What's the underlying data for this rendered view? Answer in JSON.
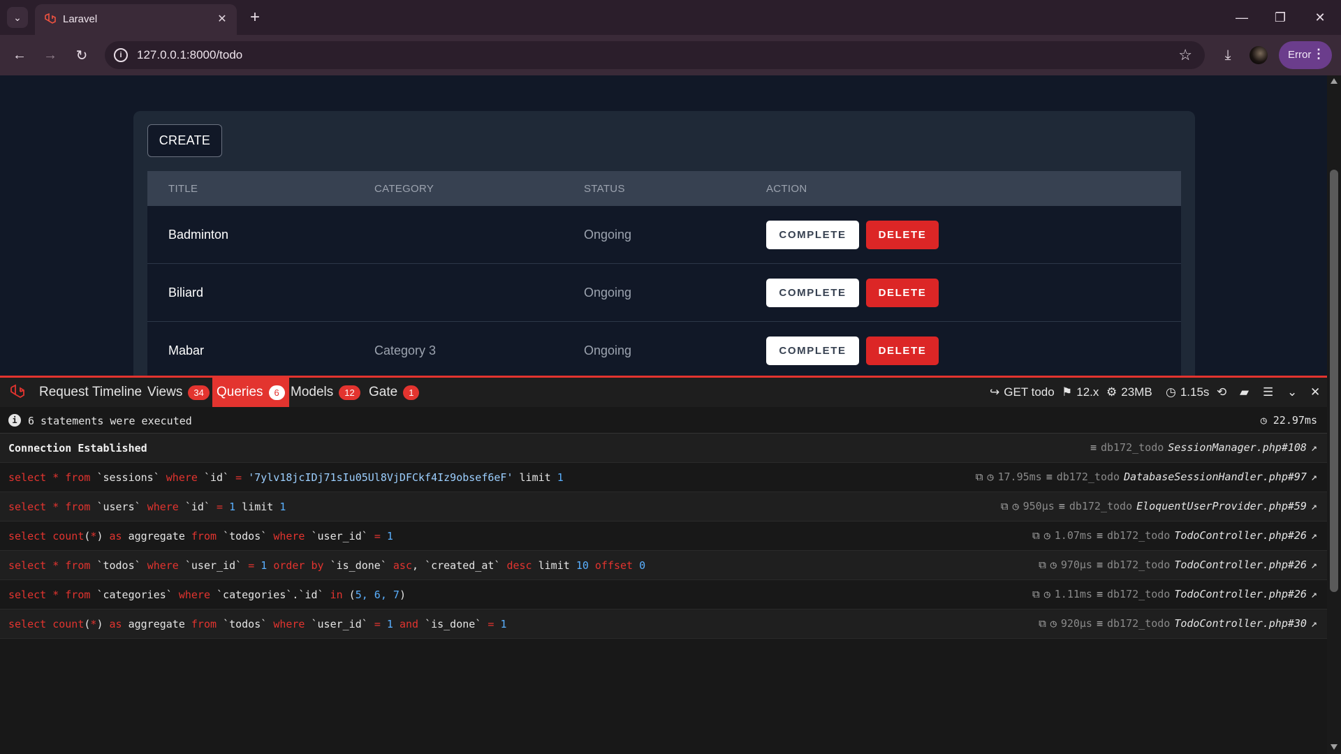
{
  "browser": {
    "tab_title": "Laravel",
    "url": "127.0.0.1:8000/todo",
    "error_label": "Error"
  },
  "page": {
    "create_label": "CREATE",
    "columns": [
      "TITLE",
      "CATEGORY",
      "STATUS",
      "ACTION"
    ],
    "rows": [
      {
        "title": "Badminton",
        "category": "",
        "status": "Ongoing"
      },
      {
        "title": "Biliard",
        "category": "",
        "status": "Ongoing"
      },
      {
        "title": "Mabar",
        "category": "Category 3",
        "status": "Ongoing"
      }
    ],
    "complete_label": "COMPLETE",
    "delete_label": "DELETE"
  },
  "debugbar": {
    "tabs": [
      {
        "label": "Request",
        "badge": ""
      },
      {
        "label": "Timeline",
        "badge": ""
      },
      {
        "label": "Views",
        "badge": "34"
      },
      {
        "label": "Queries",
        "badge": "6"
      },
      {
        "label": "Models",
        "badge": "12"
      },
      {
        "label": "Gate",
        "badge": "1"
      }
    ],
    "method_route": "GET todo",
    "version": "12.x",
    "memory": "23MB",
    "duration": "1.15s",
    "summary_text": "6 statements were executed",
    "summary_time": "22.97ms",
    "connection": {
      "label": "Connection Established",
      "db": "db172_todo",
      "file": "SessionManager.php#108"
    },
    "queries": [
      {
        "time": "17.95ms",
        "db": "db172_todo",
        "file": "DatabaseSessionHandler.php#97"
      },
      {
        "time": "950μs",
        "db": "db172_todo",
        "file": "EloquentUserProvider.php#59"
      },
      {
        "time": "1.07ms",
        "db": "db172_todo",
        "file": "TodoController.php#26"
      },
      {
        "time": "970μs",
        "db": "db172_todo",
        "file": "TodoController.php#26"
      },
      {
        "time": "1.11ms",
        "db": "db172_todo",
        "file": "TodoController.php#26"
      },
      {
        "time": "920μs",
        "db": "db172_todo",
        "file": "TodoController.php#30"
      }
    ],
    "sql": {
      "q1_tbl": "`sessions`",
      "q1_col": "`id`",
      "q1_val": "'7ylv18jcIDj71sIu05Ul8VjDFCkf4Iz9obsef6eF'",
      "q1_lim": "1",
      "q2_tbl": "`users`",
      "q2_col": "`id`",
      "q2_val": "1",
      "q2_lim": "1",
      "q3_tbl": "`todos`",
      "q3_col": "`user_id`",
      "q3_val": "1",
      "q4_tbl": "`todos`",
      "q4_col": "`user_id`",
      "q4_val": "1",
      "q4_o1": "`is_done`",
      "q4_o2": "`created_at`",
      "q4_lim": "10",
      "q4_off": "0",
      "q5_tbl": "`categories`",
      "q5_col": "`categories`.`id`",
      "q5_list": "5, 6, 7",
      "q6_tbl": "`todos`",
      "q6_col1": "`user_id`",
      "q6_val1": "1",
      "q6_col2": "`is_done`",
      "q6_val2": "1"
    }
  },
  "colors": {
    "accent_red": "#e3342f",
    "delete_red": "#dc2626",
    "page_bg": "#111827",
    "card_bg": "#1f2937",
    "chrome_purple": "#3a2a38"
  }
}
